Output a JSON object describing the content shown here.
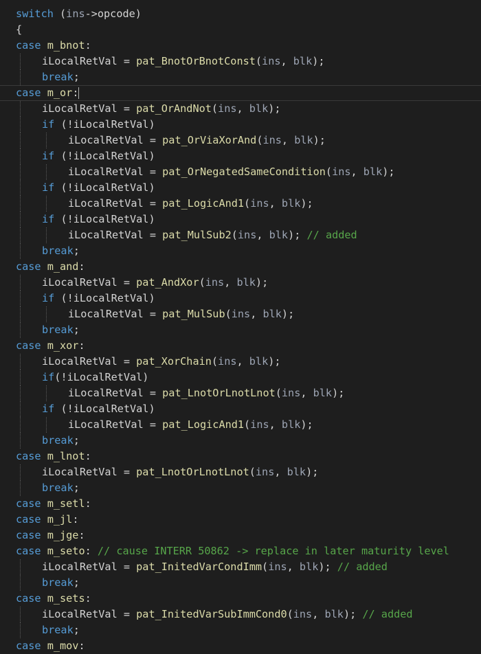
{
  "editor": {
    "colors": {
      "background": "#1e1e1e",
      "keyword": "#569cd6",
      "function": "#dcdcaa",
      "variable": "#9cdcfe",
      "comment": "#57a64a",
      "text": "#d4d4d4",
      "param": "#9da5b4"
    },
    "lines": [
      {
        "indent": 0,
        "tokens": [
          {
            "t": "kw",
            "v": "switch"
          },
          {
            "t": "plain",
            "v": " ("
          },
          {
            "t": "param",
            "v": "ins"
          },
          {
            "t": "plain",
            "v": "->opcode)"
          }
        ]
      },
      {
        "indent": 0,
        "tokens": [
          {
            "t": "plain",
            "v": "{"
          }
        ]
      },
      {
        "indent": 0,
        "tokens": [
          {
            "t": "kw",
            "v": "case"
          },
          {
            "t": "plain",
            "v": " "
          },
          {
            "t": "case-name",
            "v": "m_bnot"
          },
          {
            "t": "plain",
            "v": ":"
          }
        ]
      },
      {
        "indent": 1,
        "tokens": [
          {
            "t": "plain",
            "v": "iLocalRetVal = "
          },
          {
            "t": "fn",
            "v": "pat_BnotOrBnotConst"
          },
          {
            "t": "plain",
            "v": "("
          },
          {
            "t": "param",
            "v": "ins"
          },
          {
            "t": "plain",
            "v": ", "
          },
          {
            "t": "param",
            "v": "blk"
          },
          {
            "t": "plain",
            "v": ");"
          }
        ]
      },
      {
        "indent": 1,
        "tokens": [
          {
            "t": "kw",
            "v": "break"
          },
          {
            "t": "plain",
            "v": ";"
          }
        ]
      },
      {
        "indent": 0,
        "current": true,
        "tokens": [
          {
            "t": "kw",
            "v": "case"
          },
          {
            "t": "plain",
            "v": " "
          },
          {
            "t": "case-name",
            "v": "m_or"
          },
          {
            "t": "plain",
            "v": ":"
          }
        ]
      },
      {
        "indent": 1,
        "tokens": [
          {
            "t": "plain",
            "v": "iLocalRetVal = "
          },
          {
            "t": "fn",
            "v": "pat_OrAndNot"
          },
          {
            "t": "plain",
            "v": "("
          },
          {
            "t": "param",
            "v": "ins"
          },
          {
            "t": "plain",
            "v": ", "
          },
          {
            "t": "param",
            "v": "blk"
          },
          {
            "t": "plain",
            "v": ");"
          }
        ]
      },
      {
        "indent": 1,
        "tokens": [
          {
            "t": "kw",
            "v": "if"
          },
          {
            "t": "plain",
            "v": " (!iLocalRetVal)"
          }
        ]
      },
      {
        "indent": 2,
        "tokens": [
          {
            "t": "plain",
            "v": "iLocalRetVal = "
          },
          {
            "t": "fn",
            "v": "pat_OrViaXorAnd"
          },
          {
            "t": "plain",
            "v": "("
          },
          {
            "t": "param",
            "v": "ins"
          },
          {
            "t": "plain",
            "v": ", "
          },
          {
            "t": "param",
            "v": "blk"
          },
          {
            "t": "plain",
            "v": ");"
          }
        ]
      },
      {
        "indent": 1,
        "tokens": [
          {
            "t": "kw",
            "v": "if"
          },
          {
            "t": "plain",
            "v": " (!iLocalRetVal)"
          }
        ]
      },
      {
        "indent": 2,
        "tokens": [
          {
            "t": "plain",
            "v": "iLocalRetVal = "
          },
          {
            "t": "fn",
            "v": "pat_OrNegatedSameCondition"
          },
          {
            "t": "plain",
            "v": "("
          },
          {
            "t": "param",
            "v": "ins"
          },
          {
            "t": "plain",
            "v": ", "
          },
          {
            "t": "param",
            "v": "blk"
          },
          {
            "t": "plain",
            "v": ");"
          }
        ]
      },
      {
        "indent": 1,
        "tokens": [
          {
            "t": "kw",
            "v": "if"
          },
          {
            "t": "plain",
            "v": " (!iLocalRetVal)"
          }
        ]
      },
      {
        "indent": 2,
        "tokens": [
          {
            "t": "plain",
            "v": "iLocalRetVal = "
          },
          {
            "t": "fn",
            "v": "pat_LogicAnd1"
          },
          {
            "t": "plain",
            "v": "("
          },
          {
            "t": "param",
            "v": "ins"
          },
          {
            "t": "plain",
            "v": ", "
          },
          {
            "t": "param",
            "v": "blk"
          },
          {
            "t": "plain",
            "v": ");"
          }
        ]
      },
      {
        "indent": 1,
        "tokens": [
          {
            "t": "kw",
            "v": "if"
          },
          {
            "t": "plain",
            "v": " (!iLocalRetVal)"
          }
        ]
      },
      {
        "indent": 2,
        "tokens": [
          {
            "t": "plain",
            "v": "iLocalRetVal = "
          },
          {
            "t": "fn",
            "v": "pat_MulSub2"
          },
          {
            "t": "plain",
            "v": "("
          },
          {
            "t": "param",
            "v": "ins"
          },
          {
            "t": "plain",
            "v": ", "
          },
          {
            "t": "param",
            "v": "blk"
          },
          {
            "t": "plain",
            "v": "); "
          },
          {
            "t": "cmt",
            "v": "// added"
          }
        ]
      },
      {
        "indent": 1,
        "tokens": [
          {
            "t": "kw",
            "v": "break"
          },
          {
            "t": "plain",
            "v": ";"
          }
        ]
      },
      {
        "indent": 0,
        "tokens": [
          {
            "t": "kw",
            "v": "case"
          },
          {
            "t": "plain",
            "v": " "
          },
          {
            "t": "case-name",
            "v": "m_and"
          },
          {
            "t": "plain",
            "v": ":"
          }
        ]
      },
      {
        "indent": 1,
        "tokens": [
          {
            "t": "plain",
            "v": "iLocalRetVal = "
          },
          {
            "t": "fn",
            "v": "pat_AndXor"
          },
          {
            "t": "plain",
            "v": "("
          },
          {
            "t": "param",
            "v": "ins"
          },
          {
            "t": "plain",
            "v": ", "
          },
          {
            "t": "param",
            "v": "blk"
          },
          {
            "t": "plain",
            "v": ");"
          }
        ]
      },
      {
        "indent": 1,
        "tokens": [
          {
            "t": "kw",
            "v": "if"
          },
          {
            "t": "plain",
            "v": " (!iLocalRetVal)"
          }
        ]
      },
      {
        "indent": 2,
        "tokens": [
          {
            "t": "plain",
            "v": "iLocalRetVal = "
          },
          {
            "t": "fn",
            "v": "pat_MulSub"
          },
          {
            "t": "plain",
            "v": "("
          },
          {
            "t": "param",
            "v": "ins"
          },
          {
            "t": "plain",
            "v": ", "
          },
          {
            "t": "param",
            "v": "blk"
          },
          {
            "t": "plain",
            "v": ");"
          }
        ]
      },
      {
        "indent": 1,
        "tokens": [
          {
            "t": "kw",
            "v": "break"
          },
          {
            "t": "plain",
            "v": ";"
          }
        ]
      },
      {
        "indent": 0,
        "tokens": [
          {
            "t": "kw",
            "v": "case"
          },
          {
            "t": "plain",
            "v": " "
          },
          {
            "t": "case-name",
            "v": "m_xor"
          },
          {
            "t": "plain",
            "v": ":"
          }
        ]
      },
      {
        "indent": 1,
        "tokens": [
          {
            "t": "plain",
            "v": "iLocalRetVal = "
          },
          {
            "t": "fn",
            "v": "pat_XorChain"
          },
          {
            "t": "plain",
            "v": "("
          },
          {
            "t": "param",
            "v": "ins"
          },
          {
            "t": "plain",
            "v": ", "
          },
          {
            "t": "param",
            "v": "blk"
          },
          {
            "t": "plain",
            "v": ");"
          }
        ]
      },
      {
        "indent": 1,
        "tokens": [
          {
            "t": "kw",
            "v": "if"
          },
          {
            "t": "plain",
            "v": "(!iLocalRetVal)"
          }
        ]
      },
      {
        "indent": 2,
        "tokens": [
          {
            "t": "plain",
            "v": "iLocalRetVal = "
          },
          {
            "t": "fn",
            "v": "pat_LnotOrLnotLnot"
          },
          {
            "t": "plain",
            "v": "("
          },
          {
            "t": "param",
            "v": "ins"
          },
          {
            "t": "plain",
            "v": ", "
          },
          {
            "t": "param",
            "v": "blk"
          },
          {
            "t": "plain",
            "v": ");"
          }
        ]
      },
      {
        "indent": 1,
        "tokens": [
          {
            "t": "kw",
            "v": "if"
          },
          {
            "t": "plain",
            "v": " (!iLocalRetVal)"
          }
        ]
      },
      {
        "indent": 2,
        "tokens": [
          {
            "t": "plain",
            "v": "iLocalRetVal = "
          },
          {
            "t": "fn",
            "v": "pat_LogicAnd1"
          },
          {
            "t": "plain",
            "v": "("
          },
          {
            "t": "param",
            "v": "ins"
          },
          {
            "t": "plain",
            "v": ", "
          },
          {
            "t": "param",
            "v": "blk"
          },
          {
            "t": "plain",
            "v": ");"
          }
        ]
      },
      {
        "indent": 1,
        "tokens": [
          {
            "t": "kw",
            "v": "break"
          },
          {
            "t": "plain",
            "v": ";"
          }
        ]
      },
      {
        "indent": 0,
        "tokens": [
          {
            "t": "kw",
            "v": "case"
          },
          {
            "t": "plain",
            "v": " "
          },
          {
            "t": "case-name",
            "v": "m_lnot"
          },
          {
            "t": "plain",
            "v": ":"
          }
        ]
      },
      {
        "indent": 1,
        "tokens": [
          {
            "t": "plain",
            "v": "iLocalRetVal = "
          },
          {
            "t": "fn",
            "v": "pat_LnotOrLnotLnot"
          },
          {
            "t": "plain",
            "v": "("
          },
          {
            "t": "param",
            "v": "ins"
          },
          {
            "t": "plain",
            "v": ", "
          },
          {
            "t": "param",
            "v": "blk"
          },
          {
            "t": "plain",
            "v": ");"
          }
        ]
      },
      {
        "indent": 1,
        "tokens": [
          {
            "t": "kw",
            "v": "break"
          },
          {
            "t": "plain",
            "v": ";"
          }
        ]
      },
      {
        "indent": 0,
        "tokens": [
          {
            "t": "kw",
            "v": "case"
          },
          {
            "t": "plain",
            "v": " "
          },
          {
            "t": "case-name",
            "v": "m_setl"
          },
          {
            "t": "plain",
            "v": ":"
          }
        ]
      },
      {
        "indent": 0,
        "tokens": [
          {
            "t": "kw",
            "v": "case"
          },
          {
            "t": "plain",
            "v": " "
          },
          {
            "t": "case-name",
            "v": "m_jl"
          },
          {
            "t": "plain",
            "v": ":"
          }
        ]
      },
      {
        "indent": 0,
        "tokens": [
          {
            "t": "kw",
            "v": "case"
          },
          {
            "t": "plain",
            "v": " "
          },
          {
            "t": "case-name",
            "v": "m_jge"
          },
          {
            "t": "plain",
            "v": ":"
          }
        ]
      },
      {
        "indent": 0,
        "tokens": [
          {
            "t": "kw",
            "v": "case"
          },
          {
            "t": "plain",
            "v": " "
          },
          {
            "t": "case-name",
            "v": "m_seto"
          },
          {
            "t": "plain",
            "v": ": "
          },
          {
            "t": "cmt",
            "v": "// cause INTERR 50862 -> replace in later maturity level"
          }
        ]
      },
      {
        "indent": 1,
        "tokens": [
          {
            "t": "plain",
            "v": "iLocalRetVal = "
          },
          {
            "t": "fn",
            "v": "pat_InitedVarCondImm"
          },
          {
            "t": "plain",
            "v": "("
          },
          {
            "t": "param",
            "v": "ins"
          },
          {
            "t": "plain",
            "v": ", "
          },
          {
            "t": "param",
            "v": "blk"
          },
          {
            "t": "plain",
            "v": "); "
          },
          {
            "t": "cmt",
            "v": "// added"
          }
        ]
      },
      {
        "indent": 1,
        "tokens": [
          {
            "t": "kw",
            "v": "break"
          },
          {
            "t": "plain",
            "v": ";"
          }
        ]
      },
      {
        "indent": 0,
        "tokens": [
          {
            "t": "kw",
            "v": "case"
          },
          {
            "t": "plain",
            "v": " "
          },
          {
            "t": "case-name",
            "v": "m_sets"
          },
          {
            "t": "plain",
            "v": ":"
          }
        ]
      },
      {
        "indent": 1,
        "tokens": [
          {
            "t": "plain",
            "v": "iLocalRetVal = "
          },
          {
            "t": "fn",
            "v": "pat_InitedVarSubImmCond0"
          },
          {
            "t": "plain",
            "v": "("
          },
          {
            "t": "param",
            "v": "ins"
          },
          {
            "t": "plain",
            "v": ", "
          },
          {
            "t": "param",
            "v": "blk"
          },
          {
            "t": "plain",
            "v": "); "
          },
          {
            "t": "cmt",
            "v": "// added"
          }
        ]
      },
      {
        "indent": 1,
        "tokens": [
          {
            "t": "kw",
            "v": "break"
          },
          {
            "t": "plain",
            "v": ";"
          }
        ]
      },
      {
        "indent": 0,
        "tokens": [
          {
            "t": "kw",
            "v": "case"
          },
          {
            "t": "plain",
            "v": " "
          },
          {
            "t": "case-name",
            "v": "m_mov"
          },
          {
            "t": "plain",
            "v": ":"
          }
        ]
      }
    ]
  }
}
